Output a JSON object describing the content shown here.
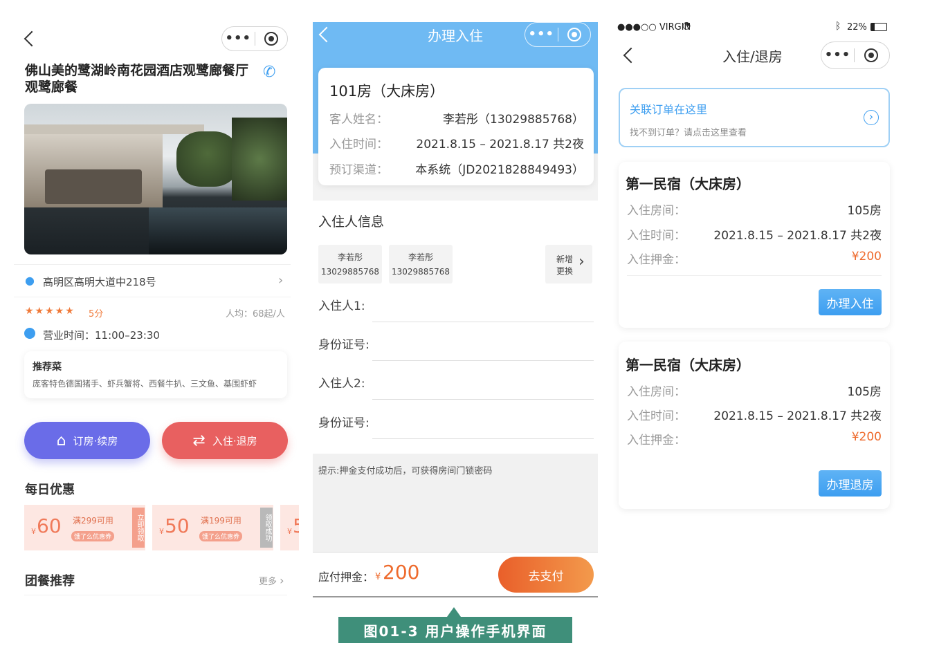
{
  "left": {
    "restaurant_name": "佛山美的鹭湖岭南花园酒店观鹭廊餐厅观鹭廊餐",
    "address": "高明区高明大道中218号",
    "rating_text": "5分",
    "avg_price": "人均：68起/人",
    "hours": "营业时间：11:00–23:30",
    "recommend_title": "推荐菜",
    "recommend_dishes": "庞客特色德国猪手、虾兵蟹将、西餐牛扒、三文鱼、基围虾虾",
    "btn_book": "订房·续房",
    "btn_checkin": "入住·退房",
    "daily_title": "每日优惠",
    "coupons": [
      {
        "symbol": "¥",
        "amount": "60",
        "cond": "满299可用",
        "sub": "饿了么优惠券",
        "action": "立即领取"
      },
      {
        "symbol": "¥",
        "amount": "50",
        "cond": "满199可用",
        "sub": "饿了么优惠券",
        "action": "领取成功"
      },
      {
        "symbol": "¥",
        "amount": "5",
        "cond": "",
        "sub": "",
        "action": ""
      }
    ],
    "group_title": "团餐推荐",
    "more": "更多"
  },
  "middle": {
    "nav_title": "办理入住",
    "room_title": "101房（大床房）",
    "guest_label": "客人姓名：",
    "guest_value": "李若彤（13029885768）",
    "time_label": "入住时间：",
    "time_value": "2021.8.15 – 2021.8.17 共2夜",
    "channel_label": "预订渠道：",
    "channel_value": "本系统（JD2021828849493）",
    "section_title": "入住人信息",
    "guests": [
      {
        "name": "李若彤",
        "phone": "13029885768"
      },
      {
        "name": "李若彤",
        "phone": "13029885768"
      }
    ],
    "add_btn_line1": "新增",
    "add_btn_line2": "更换",
    "field_guest1": "入住人1:",
    "field_id1": "身份证号:",
    "field_guest2": "入住人2:",
    "field_id2": "身份证号:",
    "hint": "提示:押金支付成功后，可获得房间门锁密码",
    "deposit_label": "应付押金：",
    "deposit_symbol": "¥",
    "deposit_amount": "200",
    "pay_btn": "去支付"
  },
  "right": {
    "status_carrier": "●●●○○ VIRGIN",
    "status_battery": "22%",
    "nav_title": "入住/退房",
    "link_title": "关联订单在这里",
    "link_sub": "找不到订单？请点击这里查看",
    "cards": [
      {
        "title": "第一民宿（大床房）",
        "room_label": "入住房间：",
        "room_value": "105房",
        "time_label": "入住时间：",
        "time_value": "2021.8.15 – 2021.8.17 共2夜",
        "deposit_label": "入住押金：",
        "deposit_value": "¥200",
        "button": "办理入住"
      },
      {
        "title": "第一民宿（大床房）",
        "room_label": "入住房间：",
        "room_value": "105房",
        "time_label": "入住时间：",
        "time_value": "2021.8.15 – 2021.8.17 共2夜",
        "deposit_label": "入住押金：",
        "deposit_value": "¥200",
        "button": "办理退房"
      }
    ]
  },
  "caption": "图01-3  用户操作手机界面",
  "colors": {
    "blue": "#5db4f2",
    "orange": "#ee6a2c",
    "red": "#e86060",
    "purple": "#6a6ce8",
    "caption_bg": "#3f8f7a"
  }
}
